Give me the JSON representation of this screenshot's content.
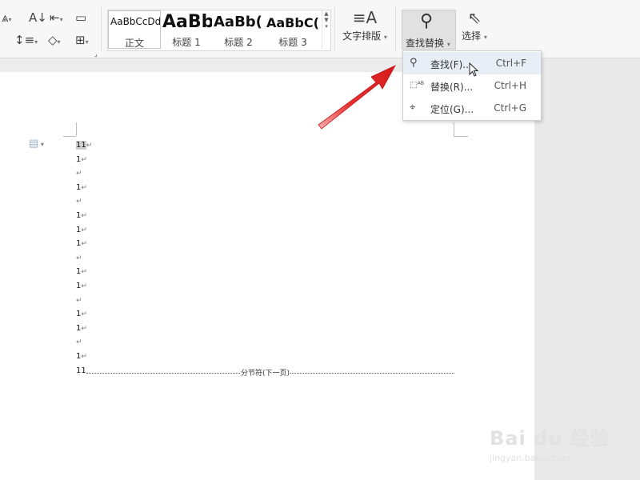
{
  "ribbon": {
    "styles": [
      {
        "sample": "AaBbCcDd",
        "label": "正文",
        "selected": true
      },
      {
        "sample": "AaBb",
        "label": "标题 1"
      },
      {
        "sample": "AaBb(",
        "label": "标题 2"
      },
      {
        "sample": "AaBbC(",
        "label": "标题 3"
      }
    ],
    "text_layout_label": "文字排版",
    "find_replace_label": "查找替换",
    "select_label": "选择"
  },
  "menu": {
    "items": [
      {
        "label": "查找(F)...",
        "shortcut": "Ctrl+F",
        "icon": "search-icon"
      },
      {
        "label": "替换(R)...",
        "shortcut": "Ctrl+H",
        "icon": "replace-icon"
      },
      {
        "label": "定位(G)...",
        "shortcut": "Ctrl+G",
        "icon": "goto-icon"
      }
    ]
  },
  "document": {
    "lines": [
      "11",
      "1",
      "",
      "1",
      "",
      "1",
      "1",
      "1",
      "",
      "1",
      "1",
      "",
      "1",
      "1",
      "",
      "1",
      "11"
    ],
    "paragraph_mark": "↵",
    "section_break": "分节符(下一页)"
  },
  "watermark": {
    "brand": "Bai du 经验",
    "url": "jingyan.baidu.com"
  },
  "colors": {
    "arrow": "#e02020",
    "menu_hover": "#e8eef6"
  }
}
